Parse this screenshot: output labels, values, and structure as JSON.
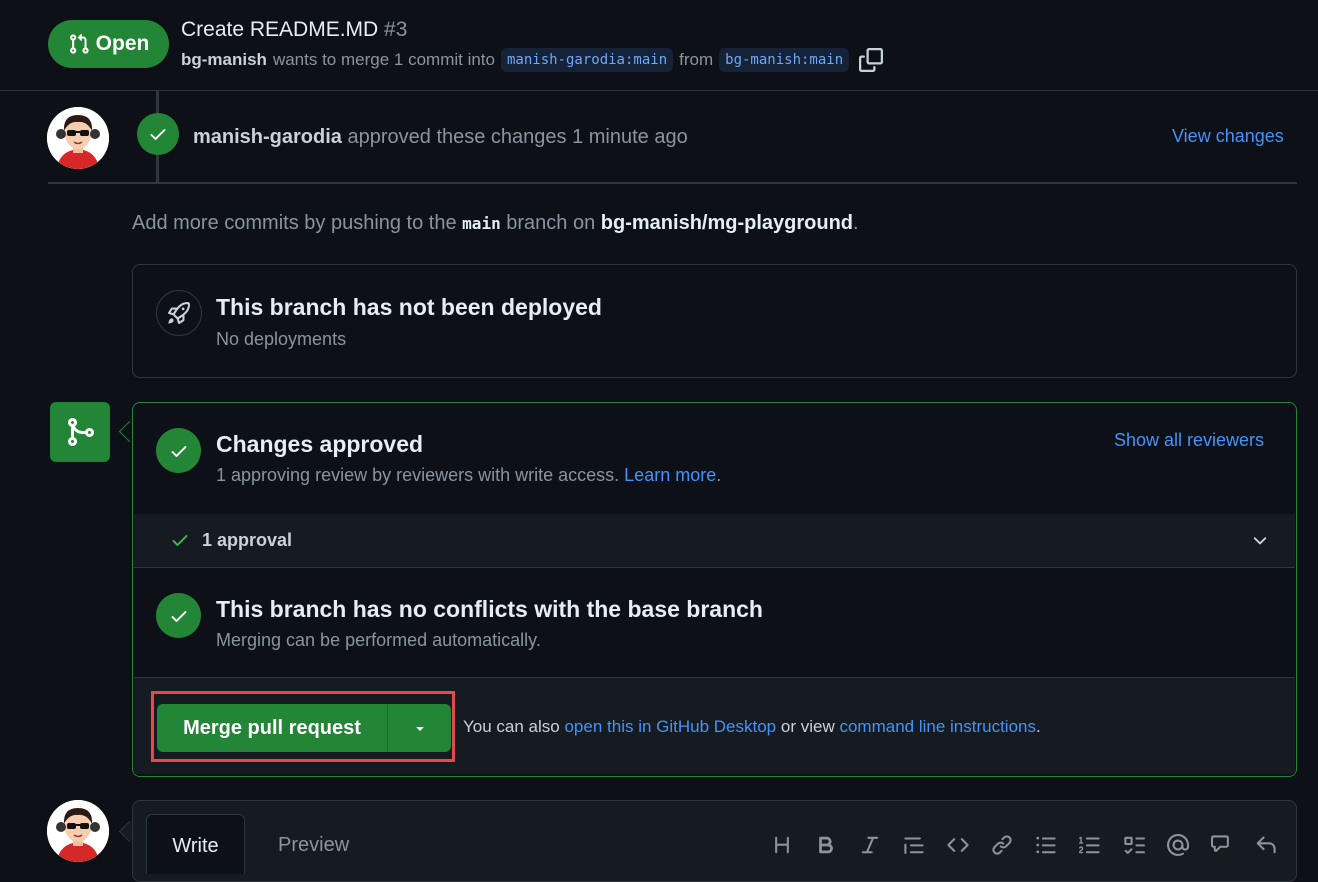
{
  "header": {
    "state": "Open",
    "title": "Create README.MD",
    "number": "#3",
    "author": "bg-manish",
    "merge_text": "wants to merge 1 commit into",
    "base_branch": "manish-garodia:main",
    "from_text": "from",
    "head_branch": "bg-manish:main"
  },
  "review": {
    "author": "manish-garodia",
    "text": "approved these changes 1 minute ago",
    "view_changes": "View changes"
  },
  "push_note": {
    "prefix": "Add more commits by pushing to the",
    "branch": "main",
    "middle": "branch on",
    "repo": "bg-manish/mg-playground",
    "suffix": "."
  },
  "deploy": {
    "title": "This branch has not been deployed",
    "subtitle": "No deployments"
  },
  "approval": {
    "title": "Changes approved",
    "subtitle": "1 approving review by reviewers with write access.",
    "learn_more": "Learn more",
    "learn_suffix": ".",
    "show_reviewers": "Show all reviewers",
    "count_label": "1 approval"
  },
  "conflicts": {
    "title": "This branch has no conflicts with the base branch",
    "subtitle": "Merging can be performed automatically."
  },
  "merge": {
    "button_label": "Merge pull request",
    "note_prefix": "You can also",
    "desktop_link": "open this in GitHub Desktop",
    "note_middle": "or view",
    "cli_link": "command line instructions",
    "note_suffix": "."
  },
  "comment": {
    "tab_write": "Write",
    "tab_preview": "Preview",
    "toolbar": [
      "heading-icon",
      "bold-icon",
      "italic-icon",
      "quote-icon",
      "code-icon",
      "link-icon",
      "bulleted-list-icon",
      "numbered-list-icon",
      "task-list-icon",
      "mention-icon",
      "cross-reference-icon",
      "reply-icon"
    ]
  },
  "colors": {
    "background": "#0d1117",
    "accent_green": "#238636",
    "link_blue": "#4493f8",
    "highlight_red": "#e5484d"
  }
}
